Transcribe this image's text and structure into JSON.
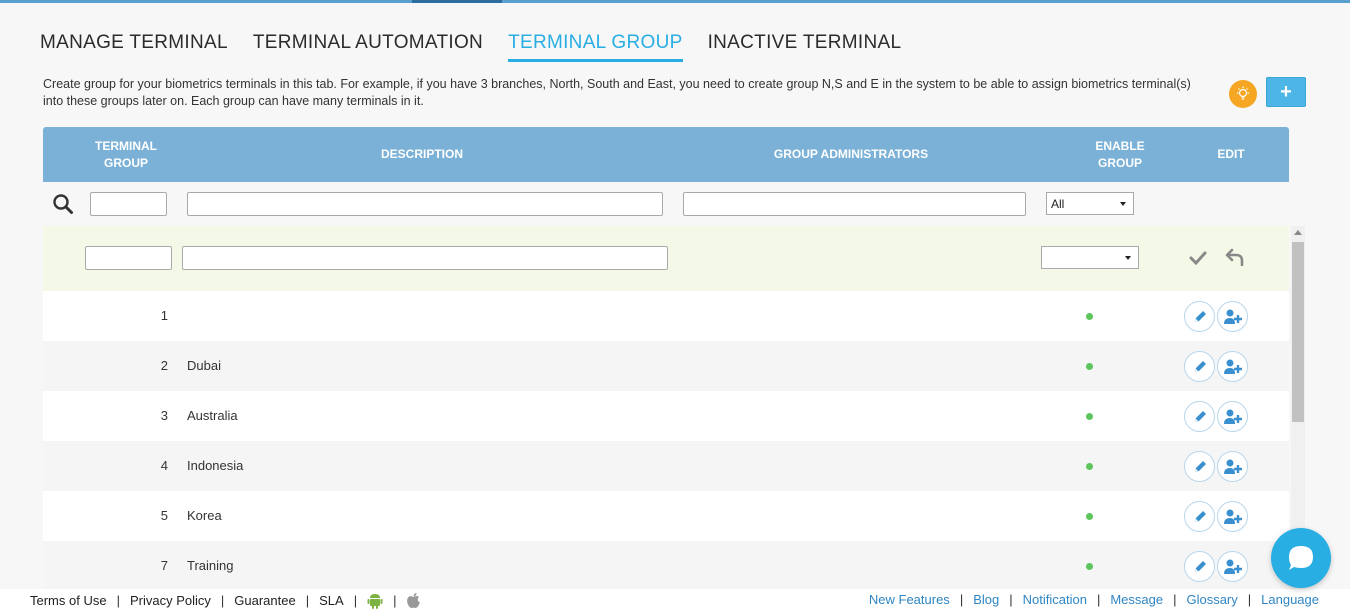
{
  "tabs": [
    {
      "label": "MANAGE TERMINAL"
    },
    {
      "label": "TERMINAL AUTOMATION"
    },
    {
      "label": "TERMINAL GROUP"
    },
    {
      "label": "INACTIVE TERMINAL"
    }
  ],
  "active_tab": "TERMINAL GROUP",
  "intro_text": "Create group for your biometrics terminals in this tab. For example, if you have 3 branches, North, South and East, you need to create group N,S and E in the system to be able to assign biometrics terminal(s) into these groups later on. Each group can have many terminals in it.",
  "toolbar": {
    "add_label": "+",
    "hint_icon": "lightbulb-icon"
  },
  "grid": {
    "columns": {
      "terminal_group": "TERMINAL GROUP",
      "description": "DESCRIPTION",
      "group_administrators": "GROUP ADMINISTRATORS",
      "enable_group": "ENABLE GROUP",
      "edit": "EDIT"
    },
    "filter": {
      "enable_group_value": "All",
      "search_icon": "search-icon"
    },
    "rows": [
      {
        "id": "1",
        "description": "",
        "enabled": true
      },
      {
        "id": "2",
        "description": "Dubai",
        "enabled": true
      },
      {
        "id": "3",
        "description": "Australia",
        "enabled": true
      },
      {
        "id": "4",
        "description": "Indonesia",
        "enabled": true
      },
      {
        "id": "5",
        "description": "Korea",
        "enabled": true
      },
      {
        "id": "7",
        "description": "Training",
        "enabled": true
      }
    ]
  },
  "footer": {
    "left": [
      "Terms of Use",
      "Privacy Policy",
      "Guarantee",
      "SLA"
    ],
    "right": [
      "New Features",
      "Blog",
      "Notification",
      "Message",
      "Glossary",
      "Language"
    ]
  },
  "colors": {
    "accent": "#29aee3",
    "header": "#7bb1d6",
    "enabled_dot": "#5cc55c",
    "new_row": "#f4f9e7"
  }
}
